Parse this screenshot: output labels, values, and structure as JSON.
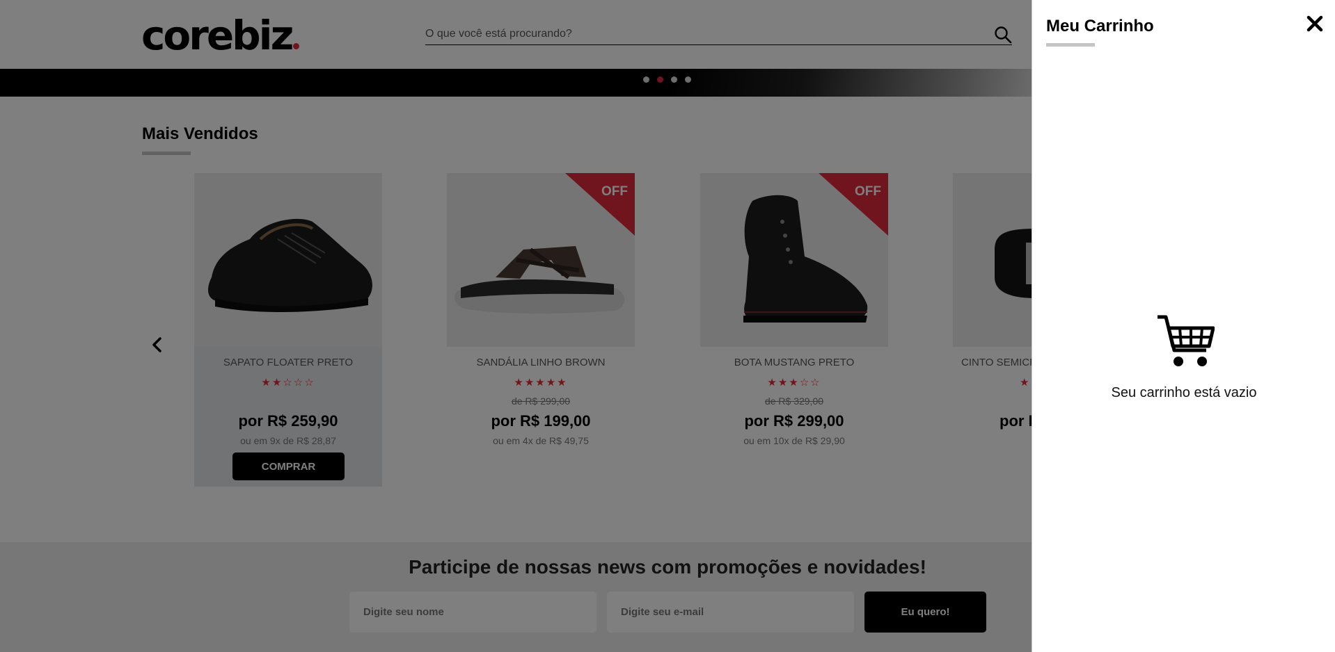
{
  "header": {
    "logo": "corebiz",
    "search_placeholder": "O que você está procurando?"
  },
  "banner": {
    "dots": 4,
    "active_dot": 2
  },
  "section": {
    "title": "Mais Vendidos"
  },
  "products": [
    {
      "name": "SAPATO FLOATER PRETO",
      "stars": "★★☆☆☆",
      "rating": 2,
      "old_price": "",
      "price": "por R$ 259,90",
      "installments": "ou em 9x de R$ 28,87",
      "buy_label": "COMPRAR",
      "off": false
    },
    {
      "name": "SANDÁLIA LINHO BROWN",
      "stars": "★★★★★",
      "rating": 5,
      "old_price": "de R$ 299,00",
      "price": "por R$ 199,00",
      "installments": "ou em 4x de R$ 49,75",
      "off": true,
      "off_label": "OFF"
    },
    {
      "name": "BOTA MUSTANG PRETO",
      "stars": "★★★☆☆",
      "rating": 3,
      "old_price": "de R$ 329,00",
      "price": "por R$ 299,00",
      "installments": "ou em 10x de R$ 29,90",
      "off": true,
      "off_label": "OFF"
    },
    {
      "name": "CINTO SEMICR",
      "stars": "★★",
      "price": "por R",
      "off": false
    }
  ],
  "newsletter": {
    "title": "Participe de nossas news com promoções e novidades!",
    "name_placeholder": "Digite seu nome",
    "email_placeholder": "Digite seu e-mail",
    "submit_label": "Eu quero!"
  },
  "cart": {
    "title": "Meu Carrinho",
    "empty_text": "Seu carrinho está vazio"
  },
  "colors": {
    "accent": "#e02b3a",
    "black": "#000000"
  }
}
